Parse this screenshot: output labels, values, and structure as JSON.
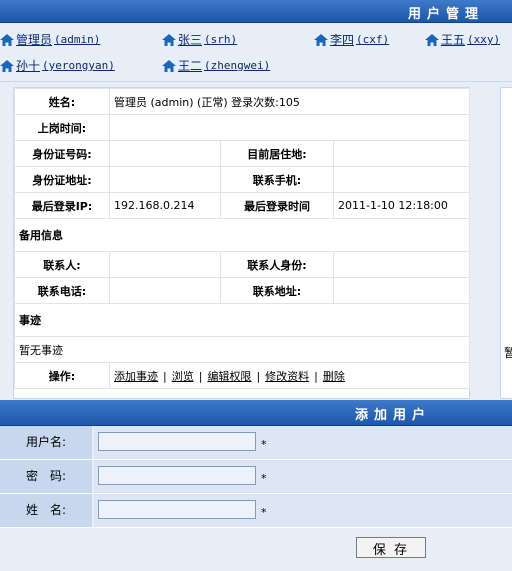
{
  "header": {
    "title": "用户管理"
  },
  "users": [
    {
      "name": "管理员",
      "login": "(admin)"
    },
    {
      "name": "张三",
      "login": "(srh)"
    },
    {
      "name": "李四",
      "login": "(cxf)"
    },
    {
      "name": "王五",
      "login": "(xxy)"
    },
    {
      "name": "孙十",
      "login": "(yerongyan)"
    },
    {
      "name": "王二",
      "login": "(zhengwei)"
    }
  ],
  "detail": {
    "name_label": "姓名:",
    "name_value": "管理员 (admin) (正常) 登录次数:105",
    "onduty_label": "上岗时间:",
    "idcard_label": "身份证号码:",
    "residence_label": "目前居住地:",
    "idaddress_label": "身份证地址:",
    "mobile_label": "联系手机:",
    "lastip_label": "最后登录IP:",
    "lastip_value": "192.168.0.214",
    "lasttime_label": "最后登录时间",
    "lasttime_value": "2011-1-10 12:18:00",
    "backup_section": "备用信息",
    "contact_label": "联系人:",
    "contact_relation_label": "联系人身份:",
    "contact_phone_label": "联系电话:",
    "contact_address_label": "联系地址:",
    "deeds_section": "事迹",
    "deeds_value": "暂无事迹",
    "ops_label": "操作:",
    "ops": [
      "添加事迹",
      "浏览",
      "编辑权限",
      "修改资料",
      "删除"
    ],
    "second_card_text": "暂"
  },
  "add_user": {
    "title": "添加用户",
    "username_label": "用户名:",
    "password_label": "密　码:",
    "realname_label": "姓　名:",
    "username_value": "",
    "password_value": "",
    "realname_value": "",
    "required_mark": "*",
    "save_label": "保 存"
  }
}
